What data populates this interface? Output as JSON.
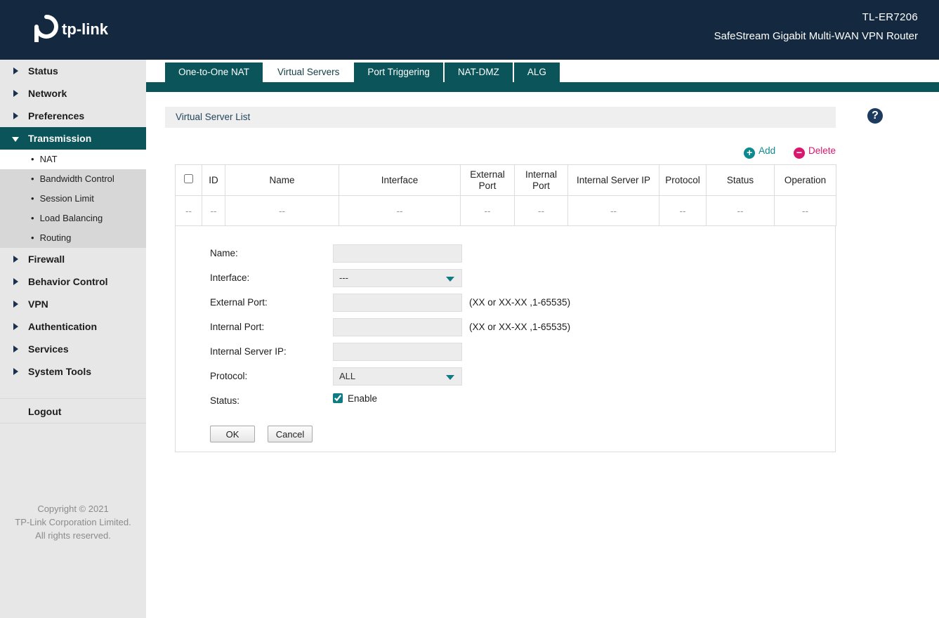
{
  "header": {
    "model": "TL-ER7206",
    "subtitle": "SafeStream Gigabit Multi-WAN VPN Router",
    "logo_text": "tp-link"
  },
  "icons": {
    "help": "?",
    "add": "+",
    "delete": "−",
    "submenu_bullet": "•"
  },
  "colors": {
    "header_bg": "#14293f",
    "teal": "#0a545a",
    "add_teal": "#0e8a8f",
    "delete_pink": "#d6186e",
    "sidebar_bg": "#e7e7e7"
  },
  "sidebar": {
    "items": [
      {
        "label": "Status"
      },
      {
        "label": "Network"
      },
      {
        "label": "Preferences"
      },
      {
        "label": "Transmission"
      },
      {
        "label": "Firewall"
      },
      {
        "label": "Behavior Control"
      },
      {
        "label": "VPN"
      },
      {
        "label": "Authentication"
      },
      {
        "label": "Services"
      },
      {
        "label": "System Tools"
      }
    ],
    "submenu": [
      "NAT",
      "Bandwidth Control",
      "Session Limit",
      "Load Balancing",
      "Routing"
    ],
    "logout": "Logout",
    "copyright": [
      "Copyright © 2021",
      "TP-Link Corporation Limited.",
      "All rights reserved."
    ]
  },
  "tabs": [
    {
      "label": "One-to-One NAT"
    },
    {
      "label": "Virtual Servers"
    },
    {
      "label": "Port Triggering"
    },
    {
      "label": "NAT-DMZ"
    },
    {
      "label": "ALG"
    }
  ],
  "section": {
    "title": "Virtual Server List"
  },
  "actions": {
    "add": "Add",
    "delete": "Delete"
  },
  "table": {
    "headers": [
      "ID",
      "Name",
      "Interface",
      "External Port",
      "Internal Port",
      "Internal Server IP",
      "Protocol",
      "Status",
      "Operation"
    ],
    "row": [
      "--",
      "--",
      "--",
      "--",
      "--",
      "--",
      "--",
      "--",
      "--",
      "--"
    ]
  },
  "form": {
    "name_label": "Name:",
    "name_value": "",
    "interface_label": "Interface:",
    "interface_value": "---",
    "external_port_label": "External Port:",
    "external_port_value": "",
    "external_port_hint": "(XX or XX-XX ,1-65535)",
    "internal_port_label": "Internal Port:",
    "internal_port_value": "",
    "internal_port_hint": "(XX or XX-XX ,1-65535)",
    "internal_server_ip_label": "Internal Server IP:",
    "internal_server_ip_value": "",
    "protocol_label": "Protocol:",
    "protocol_value": "ALL",
    "status_label": "Status:",
    "status_checkbox_label": "Enable",
    "ok": "OK",
    "cancel": "Cancel"
  }
}
